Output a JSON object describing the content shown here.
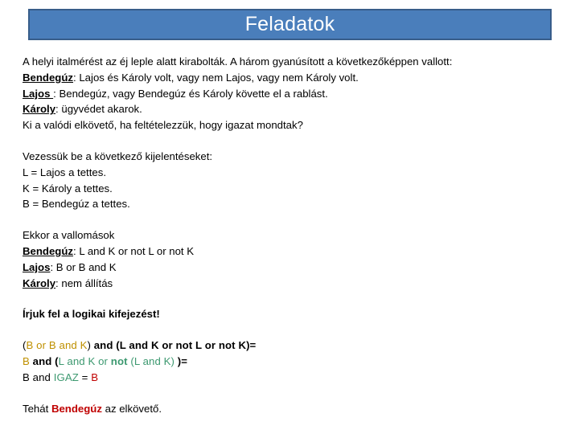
{
  "slide": {
    "title": "Feladatok",
    "colors": {
      "banner_fill": "#4A7EBB",
      "banner_border": "#385D8A",
      "banner_text": "#FFFFFF",
      "body_text": "#000000",
      "accent_tan": "#BF9000",
      "accent_green": "#3D9970",
      "accent_red": "#C00000"
    }
  },
  "body": {
    "problem": {
      "intro": "A helyi italmérést az éj leple alatt kirabolták. A három gyanúsított a következőképpen vallott:",
      "testimonies": [
        {
          "name": "Bendegúz",
          "sep": ": ",
          "text": "Lajos és Károly volt, vagy nem Lajos, vagy nem Károly volt."
        },
        {
          "name": "Lajos ",
          "sep": ": ",
          "text": "Bendegúz, vagy Bendegúz és Károly követte el a rablást."
        },
        {
          "name": "Károly",
          "sep": ":  ",
          "text": "ügyvédet akarok."
        }
      ],
      "question": "Ki a valódi elkövető, ha feltételezzük, hogy igazat mondtak?"
    },
    "definitions": {
      "heading": "Vezessük be a következő kijelentéseket:",
      "items": [
        "L = Lajos a tettes.",
        "K = Károly a tettes.",
        "B = Bendegúz a tettes."
      ]
    },
    "formalized": {
      "heading": "Ekkor a vallomások",
      "items": [
        {
          "name": "Bendegúz",
          "sep": ": ",
          "text": "L and K or not L or not K"
        },
        {
          "name": "Lajos",
          "sep": ": ",
          "text": "B or B and K"
        },
        {
          "name": "Károly",
          "sep": ": ",
          "text": "nem állítás"
        }
      ]
    },
    "expression": {
      "heading": "Írjuk fel a logikai kifejezést!",
      "line1": {
        "open_paren": "(",
        "tan_part": "B or B and K",
        "close_paren": ")",
        "rest": " and (L and K or not L or not K)="
      },
      "line2": {
        "tan_b": "B",
        "and_open": " and (",
        "green_1": "L and K or ",
        "green_not": "not",
        "green_2": " (L and K)",
        "tail": " )="
      },
      "line3": {
        "b_and": "B and ",
        "igaz": "IGAZ",
        "equals": " = ",
        "result": "B"
      }
    },
    "conclusion": {
      "prefix": "Tehát ",
      "name": "Bendegúz",
      "suffix": " az elkövető."
    }
  }
}
